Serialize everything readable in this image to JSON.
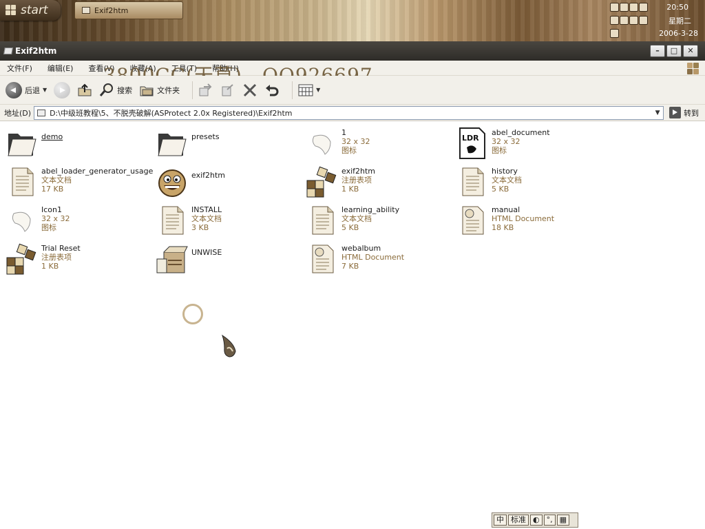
{
  "taskbar": {
    "start_label": "start",
    "task_button_label": "Exif2htm",
    "tray": {
      "time": "20:50",
      "day": "星期二",
      "date": "2006-3-28"
    }
  },
  "window": {
    "title": "Exif2htm",
    "watermark": "3800CC(天草)—QQ926697"
  },
  "menu": [
    "文件(F)",
    "编辑(E)",
    "查看(V)",
    "收藏(A)",
    "工具(T)",
    "帮助(H)"
  ],
  "toolbar": {
    "back_label": "后退",
    "search_label": "搜索",
    "folders_label": "文件夹"
  },
  "address": {
    "label": "地址(D)",
    "value": "D:\\中级班教程\\5、不脱壳破解(ASProtect 2.0x Registered)\\Exif2htm",
    "go_label": "转到"
  },
  "files": [
    {
      "name": "demo",
      "line2": "",
      "line3": "",
      "icon": "folder-icon"
    },
    {
      "name": "presets",
      "line2": "",
      "line3": "",
      "icon": "folder-icon"
    },
    {
      "name": "1",
      "line2": "32 x 32",
      "line3": "图标",
      "icon": "leaf-icon"
    },
    {
      "name": "abel_document",
      "line2": "32 x 32",
      "line3": "图标",
      "icon": "ldr-icon"
    },
    {
      "name": "abel_loader_generator_usage",
      "line2": "文本文档",
      "line3": "17 KB",
      "icon": "text-document-icon"
    },
    {
      "name": "exif2htm",
      "line2": "",
      "line3": "",
      "icon": "smiley-app-icon"
    },
    {
      "name": "exif2htm",
      "line2": "注册表项",
      "line3": "1 KB",
      "icon": "registry-icon"
    },
    {
      "name": "history",
      "line2": "文本文档",
      "line3": "5 KB",
      "icon": "text-document-icon"
    },
    {
      "name": "Icon1",
      "line2": "32 x 32",
      "line3": "图标",
      "icon": "leaf-icon"
    },
    {
      "name": "INSTALL",
      "line2": "文本文档",
      "line3": "3 KB",
      "icon": "text-document-icon"
    },
    {
      "name": "learning_ability",
      "line2": "文本文档",
      "line3": "5 KB",
      "icon": "text-document-icon"
    },
    {
      "name": "manual",
      "line2": "HTML Document",
      "line3": "18 KB",
      "icon": "html-document-icon"
    },
    {
      "name": "Trial Reset",
      "line2": "注册表项",
      "line3": "1 KB",
      "icon": "registry-icon"
    },
    {
      "name": "UNWISE",
      "line2": "",
      "line3": "",
      "icon": "uninstall-icon"
    },
    {
      "name": "webalbum",
      "line2": "HTML Document",
      "line3": "7 KB",
      "icon": "html-document-icon"
    }
  ],
  "ime": [
    "中",
    "标准",
    "",
    "",
    ""
  ],
  "colors": {
    "meta_text": "#8a6b3a",
    "title_bar": "#2e2c28"
  }
}
